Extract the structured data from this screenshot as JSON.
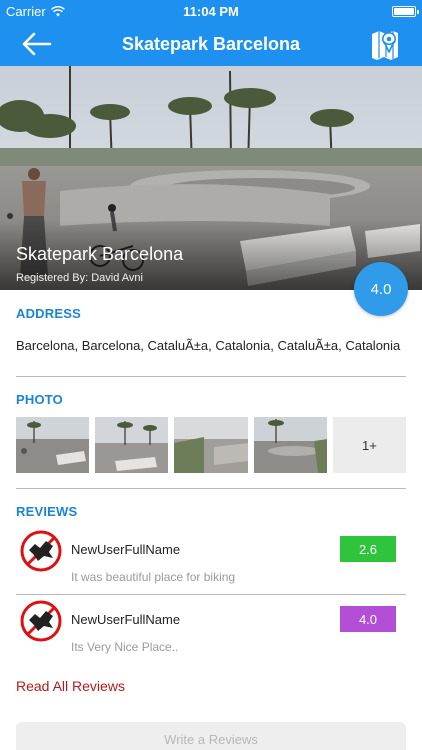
{
  "status_bar": {
    "carrier": "Carrier",
    "time": "11:04 PM",
    "battery_level": 1.0
  },
  "nav": {
    "title": "Skatepark Barcelona",
    "back_icon": "arrow-left-icon",
    "map_icon": "map-pin-icon"
  },
  "hero": {
    "title": "Skatepark Barcelona",
    "registered_by": "Registered By: David Avni",
    "rating": "4.0"
  },
  "address": {
    "heading": "ADDRESS",
    "text": "Barcelona, Barcelona, CataluÃ±a, Catalonia, CataluÃ±a, Catalonia"
  },
  "photo": {
    "heading": "PHOTO",
    "more_label": "1+",
    "thumbnail_count": 4
  },
  "reviews": {
    "heading": "REVIEWS",
    "items": [
      {
        "name": "NewUserFullName",
        "text": "It was beautiful place for biking",
        "score": "2.6",
        "score_color": "#2ec43b"
      },
      {
        "name": "NewUserFullName",
        "text": "Its Very Nice Place..",
        "score": "4.0",
        "score_color": "#b34fd6"
      }
    ],
    "read_all": "Read All Reviews",
    "write_button": "Write a Reviews"
  },
  "colors": {
    "primary": "#1e90f0",
    "section_heading": "#1a84d6",
    "rating_bubble": "#2f9be9",
    "read_all": "#b71a1a"
  }
}
